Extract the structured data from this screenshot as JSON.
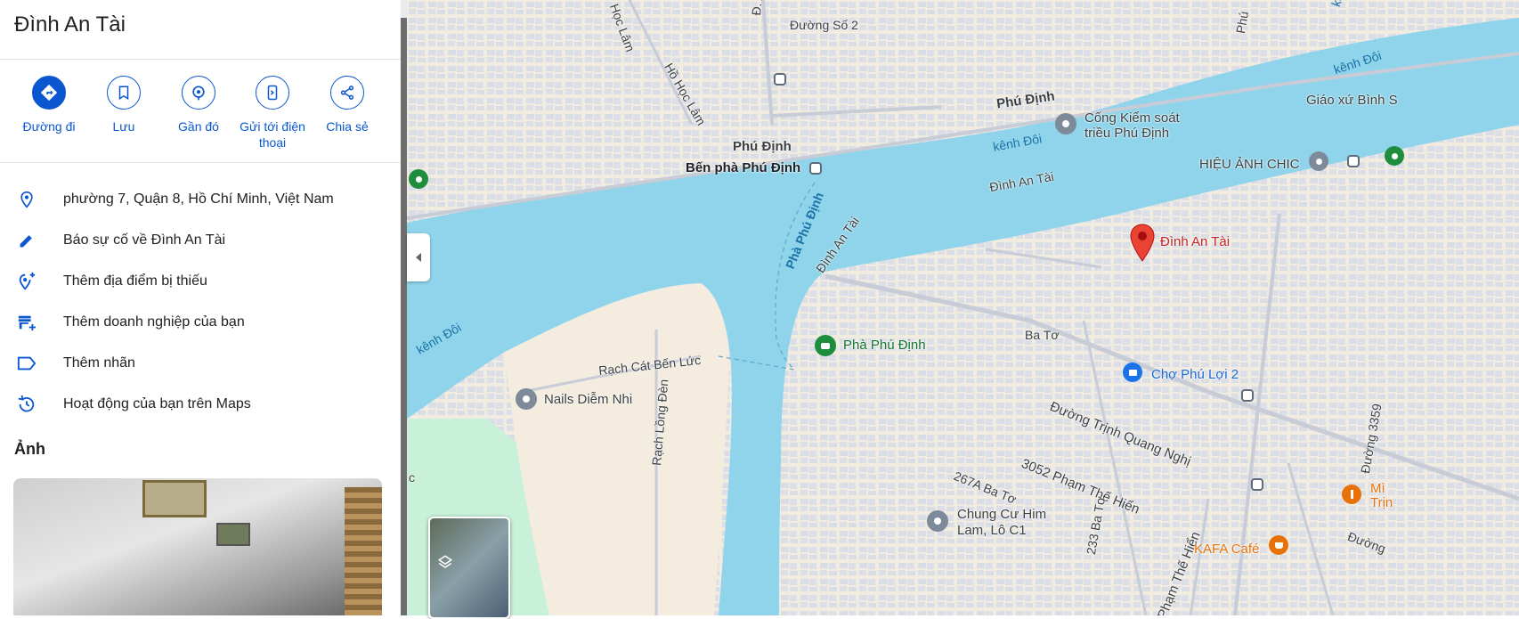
{
  "place": {
    "title": "Đình An Tài"
  },
  "actions": [
    {
      "label": "Đường đi"
    },
    {
      "label": "Lưu"
    },
    {
      "label": "Gần đó"
    },
    {
      "label": "Gửi tới điện thoại"
    },
    {
      "label": "Chia sẻ"
    }
  ],
  "info_rows": [
    {
      "text": "phường 7, Quận 8, Hồ Chí Minh, Việt Nam",
      "icon": "location-pin-icon"
    },
    {
      "text": "Báo sự cố về Đình An Tài",
      "icon": "pencil-icon"
    },
    {
      "text": "Thêm địa điểm bị thiếu",
      "icon": "add-location-icon"
    },
    {
      "text": "Thêm doanh nghiệp của bạn",
      "icon": "add-business-icon"
    },
    {
      "text": "Thêm nhãn",
      "icon": "label-icon"
    },
    {
      "text": "Hoạt động của bạn trên Maps",
      "icon": "history-icon"
    }
  ],
  "photos_section": {
    "heading": "Ảnh"
  },
  "map": {
    "labels": {
      "duong_so_2": "Đường Số 2",
      "hoc_lam": "Học Lâm",
      "ho_hoc_lam": "Hồ Học Lâm",
      "phu_dinh_1": "Phú Định",
      "phu_dinh_2": "Phú Định",
      "ben_pha": "Bến phà Phú Định",
      "cong_kiem_soat_1": "Cống Kiểm soát",
      "cong_kiem_soat_2": "triều Phú Định",
      "kenh_doi_1": "kênh Đôi",
      "kenh_doi_2": "kênh Đôi",
      "kenh_doi_3": "kênh Đôi",
      "kenh_doi_4": "kênh Đôi",
      "giao_xu": "Giáo xứ Bình S",
      "hieu_anh": "HIỆU ẢNH CHIC",
      "dinh_an_tai_road_1": "Đình An Tài",
      "dinh_an_tai_road_2": "Đình An Tài",
      "dinh_an_tai_pin": "Đình An Tài",
      "pha_phu_dinh_river": "Phà Phú Định",
      "pha_phu_dinh_poi": "Phà Phú Định",
      "ba_to": "Ba Tơ",
      "rach_cat": "Rạch Cát Bến Lức",
      "nails": "Nails Diễm Nhi",
      "rach_long_den": "Rạch Lồng Đèn",
      "cho_phu_loi": "Chợ Phú Lợi 2",
      "trinh_quang_nghi": "Đường Trịnh Quang Nghị",
      "pham_the_hien_1": "3052 Phạm Thế Hiển",
      "pham_the_hien_2": "Phạm Thế Hiển",
      "ba_to_267": "267A Ba Tơ",
      "ba_to_233": "233 Ba Tơ",
      "chung_cu_1": "Chung Cư Him",
      "chung_cu_2": "Lam, Lô C1",
      "kafa": "KAFA Café",
      "mi_1": "Mì",
      "mi_2": "Trịn",
      "duong_3359": "Đường 3359",
      "duong_edge": "Đường",
      "c_edge": "c",
      "phu_edge": "Phú",
      "d_a": "Đ. A"
    },
    "colors": {
      "water": "#8fd4ea",
      "land": "#f1ebe0",
      "block": "#d9dde6",
      "pin": "#ea4335",
      "accent": "#0b57d0",
      "park": "#c9f0d8"
    }
  }
}
